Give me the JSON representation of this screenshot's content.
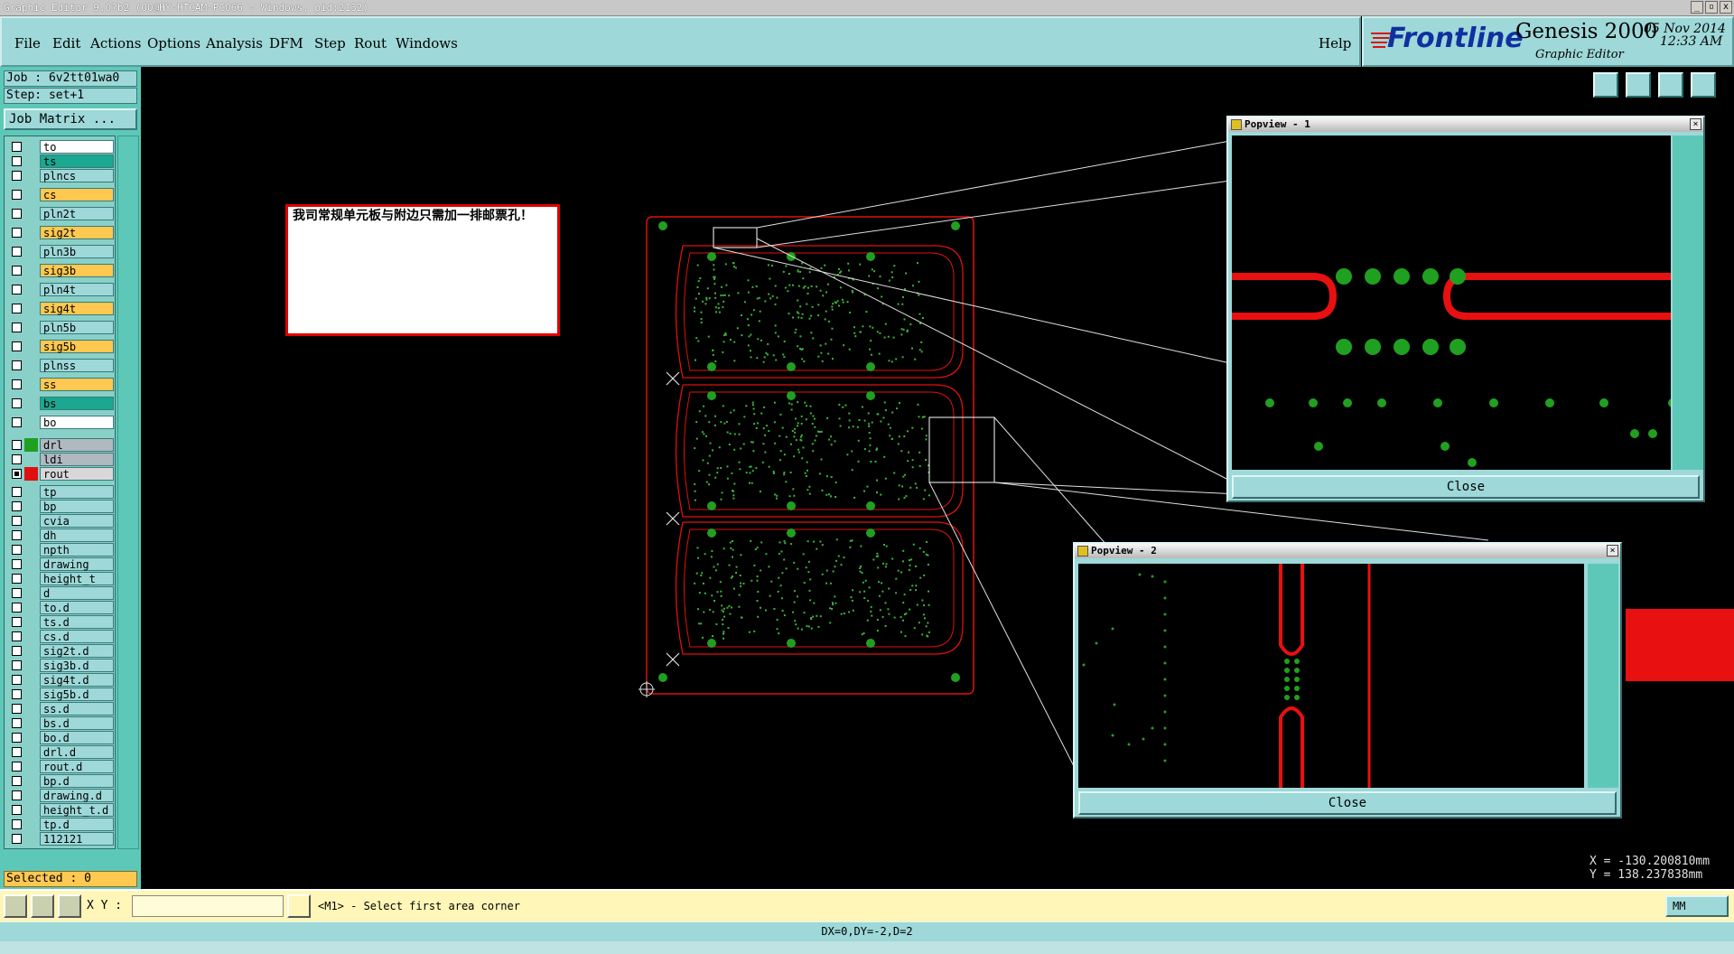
{
  "window": {
    "title": "Graphic Editor 9.0?b2 (OO@HY-HTCAM-PC066 - Windows, pid:2132)",
    "controls": [
      "_",
      "▫",
      "x"
    ]
  },
  "menu": {
    "items": [
      "File",
      "Edit",
      "Actions",
      "Options",
      "Analysis",
      "DFM",
      "Step",
      "Rout",
      "Windows"
    ],
    "help": "Help"
  },
  "brand": {
    "logo": "Frontline",
    "product": "Genesis 2000",
    "subtitle": "Graphic Editor",
    "date": "05 Nov 2014",
    "time": "12:33 AM"
  },
  "job": {
    "job_label": "Job : 6v2tt01wa0",
    "step_label": "Step: set+1",
    "matrix_button": "Job Matrix ...",
    "selected": "Selected : 0"
  },
  "layers": [
    {
      "name": "to",
      "color": "#ffffff"
    },
    {
      "name": "ts",
      "color": "#1aa890"
    },
    {
      "name": "plncs",
      "color": "#9ed8d8"
    },
    {
      "name": "cs",
      "color": "#ffc850"
    },
    {
      "name": "pln2t",
      "color": "#9ed8d8"
    },
    {
      "name": "sig2t",
      "color": "#ffc850"
    },
    {
      "name": "pln3b",
      "color": "#9ed8d8"
    },
    {
      "name": "sig3b",
      "color": "#ffc850"
    },
    {
      "name": "pln4t",
      "color": "#9ed8d8"
    },
    {
      "name": "sig4t",
      "color": "#ffc850"
    },
    {
      "name": "pln5b",
      "color": "#9ed8d8"
    },
    {
      "name": "sig5b",
      "color": "#ffc850"
    },
    {
      "name": "plnss",
      "color": "#9ed8d8"
    },
    {
      "name": "ss",
      "color": "#ffc850"
    },
    {
      "name": "bs",
      "color": "#1aa890"
    },
    {
      "name": "bo",
      "color": "#ffffff"
    },
    {
      "name": "drl",
      "color": "#b0b8c0",
      "swatch": "#20a020"
    },
    {
      "name": "ldi",
      "color": "#b0b8c0"
    },
    {
      "name": "rout",
      "color": "#d8d8d8",
      "swatch": "#e01010"
    },
    {
      "name": "tp",
      "color": "#9ed8d8"
    },
    {
      "name": "bp",
      "color": "#9ed8d8"
    },
    {
      "name": "cvia",
      "color": "#9ed8d8"
    },
    {
      "name": "dh",
      "color": "#9ed8d8"
    },
    {
      "name": "npth",
      "color": "#9ed8d8"
    },
    {
      "name": "drawing",
      "color": "#9ed8d8"
    },
    {
      "name": "height_t",
      "color": "#9ed8d8"
    },
    {
      "name": "d",
      "color": "#9ed8d8"
    },
    {
      "name": "to.d",
      "color": "#9ed8d8"
    },
    {
      "name": "ts.d",
      "color": "#9ed8d8"
    },
    {
      "name": "cs.d",
      "color": "#9ed8d8"
    },
    {
      "name": "sig2t.d",
      "color": "#9ed8d8"
    },
    {
      "name": "sig3b.d",
      "color": "#9ed8d8"
    },
    {
      "name": "sig4t.d",
      "color": "#9ed8d8"
    },
    {
      "name": "sig5b.d",
      "color": "#9ed8d8"
    },
    {
      "name": "ss.d",
      "color": "#9ed8d8"
    },
    {
      "name": "bs.d",
      "color": "#9ed8d8"
    },
    {
      "name": "bo.d",
      "color": "#9ed8d8"
    },
    {
      "name": "drl.d",
      "color": "#9ed8d8"
    },
    {
      "name": "rout.d",
      "color": "#9ed8d8"
    },
    {
      "name": "bp.d",
      "color": "#9ed8d8"
    },
    {
      "name": "drawing.d",
      "color": "#9ed8d8"
    },
    {
      "name": "height_t.d",
      "color": "#9ed8d8"
    },
    {
      "name": "tp.d",
      "color": "#9ed8d8"
    },
    {
      "name": "112121",
      "color": "#9ed8d8"
    }
  ],
  "note": {
    "text": "我司常规单元板与附边只需加一排邮票孔！"
  },
  "popview1": {
    "title": "Popview - 1",
    "close": "Close"
  },
  "popview2": {
    "title": "Popview - 2",
    "close": "Close"
  },
  "coords": {
    "x": "X = -130.200810mm",
    "y": "Y = 138.237838mm"
  },
  "bottom": {
    "xy_label": "X Y :",
    "xy_value": "",
    "prompt": "<M1> - Select first area corner",
    "units": "MM"
  },
  "status": {
    "text": "DX=0,DY=-2,D=2"
  },
  "colors": {
    "panel": "#9ed8d8",
    "rout": "#e01010",
    "drill": "#20a020",
    "highlight": "#ffc850"
  }
}
